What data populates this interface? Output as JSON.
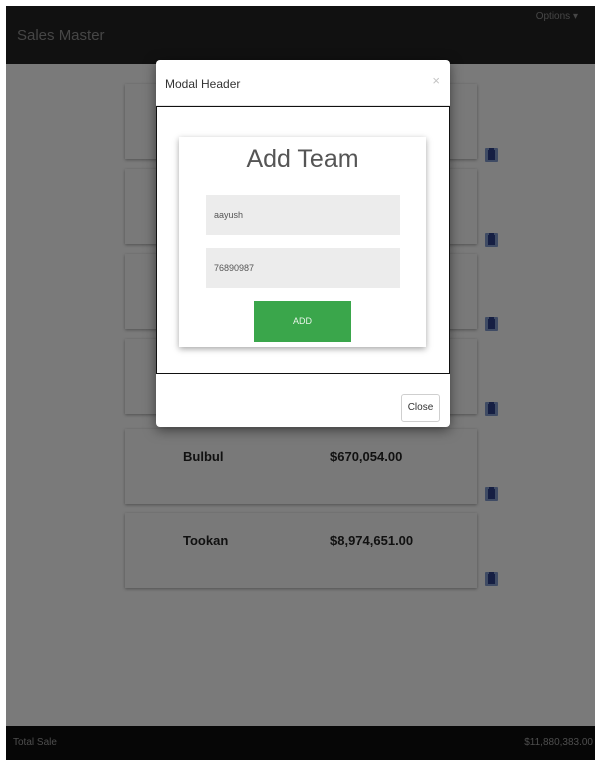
{
  "app": {
    "title": "Sales Master",
    "options_label": "Options"
  },
  "teams": [
    {
      "name": "",
      "amount": ""
    },
    {
      "name": "",
      "amount": ""
    },
    {
      "name": "",
      "amount": ""
    },
    {
      "name": "",
      "amount": ""
    },
    {
      "name": "Bulbul",
      "amount": "$670,054.00"
    },
    {
      "name": "Tookan",
      "amount": "$8,974,651.00"
    }
  ],
  "footer": {
    "label": "Total Sale",
    "total": "$11,880,383.00"
  },
  "modal": {
    "header": "Modal Header",
    "close_x": "×",
    "form_title": "Add Team",
    "name_value": "aayush",
    "number_value": "76890987",
    "add_label": "ADD",
    "close_label": "Close"
  },
  "icons": {
    "delete": "trash-icon",
    "dismiss": "close-icon",
    "dropdown": "caret-down-icon"
  },
  "colors": {
    "navbar": "#222222",
    "footer": "#0d0d0d",
    "add_button": "#3aa64b",
    "trash": "#2d3f86"
  }
}
